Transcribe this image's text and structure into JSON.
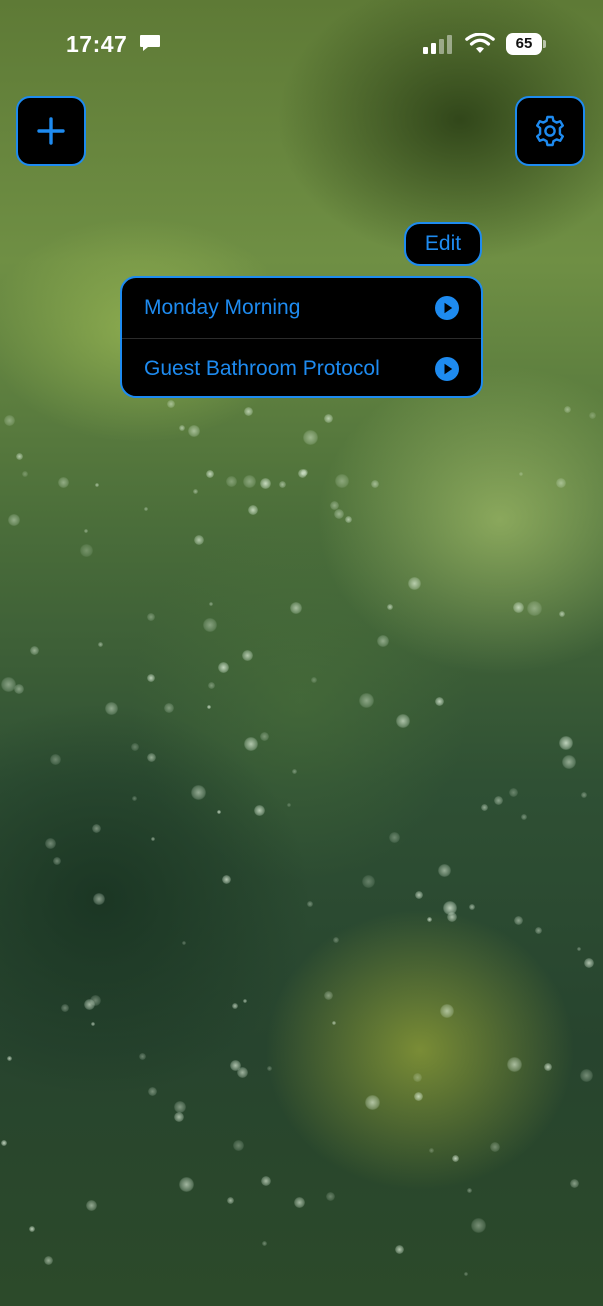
{
  "status_bar": {
    "time": "17:47",
    "battery": "65"
  },
  "toolbar": {
    "add_icon": "plus-icon",
    "settings_icon": "gear-icon",
    "edit_label": "Edit"
  },
  "shortcuts": [
    {
      "label": "Monday Morning",
      "icon": "play-circle-icon"
    },
    {
      "label": "Guest Bathroom Protocol",
      "icon": "play-circle-icon"
    }
  ],
  "colors": {
    "accent": "#1e8bf0",
    "panel_background": "#000000"
  }
}
